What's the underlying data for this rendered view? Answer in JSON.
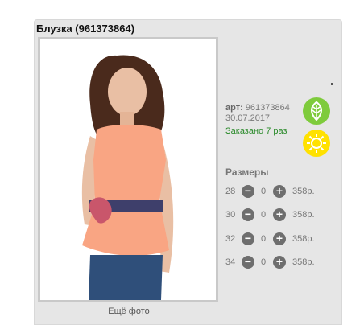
{
  "product": {
    "title": "Блузка (961373864)",
    "art_label": "арт:",
    "art_value": "961373864",
    "date": "30.07.2017",
    "ordered": "Заказано 7 раз",
    "more_photos": "Ещё фото"
  },
  "icons": {
    "season_leaf": "leaf-icon",
    "season_sun": "sun-icon"
  },
  "sizes": {
    "title": "Размеры",
    "rows": [
      {
        "size": "28",
        "qty": "0",
        "price": "358р."
      },
      {
        "size": "30",
        "qty": "0",
        "price": "358р."
      },
      {
        "size": "32",
        "qty": "0",
        "price": "358р."
      },
      {
        "size": "34",
        "qty": "0",
        "price": "358р."
      }
    ],
    "minus_glyph": "−",
    "plus_glyph": "+"
  },
  "colors": {
    "card_bg": "#e6e6e6",
    "leaf_green": "#7ecb3c",
    "sun_yellow": "#ffe100",
    "ordered_green": "#2a8a2a",
    "blouse_peach": "#f9a583"
  }
}
